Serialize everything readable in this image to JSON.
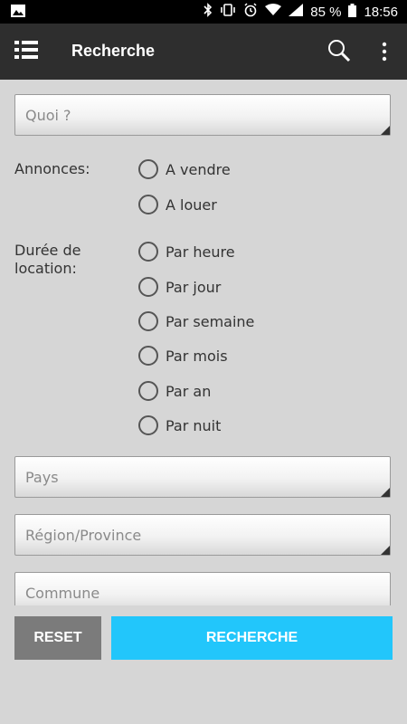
{
  "status_bar": {
    "battery": "85 %",
    "time": "18:56"
  },
  "app_bar": {
    "title": "Recherche"
  },
  "form": {
    "quoi_placeholder": "Quoi ?",
    "annonces_label": "Annonces:",
    "annonces_options": [
      "A vendre",
      "A louer"
    ],
    "duree_label_line1": "Durée de",
    "duree_label_line2": "location:",
    "duree_options": [
      "Par heure",
      "Par jour",
      "Par semaine",
      "Par mois",
      "Par an",
      "Par nuit"
    ],
    "pays_placeholder": "Pays",
    "region_placeholder": "Région/Province",
    "commune_placeholder": "Commune"
  },
  "buttons": {
    "reset": "RESET",
    "recherche": "RECHERCHE"
  }
}
